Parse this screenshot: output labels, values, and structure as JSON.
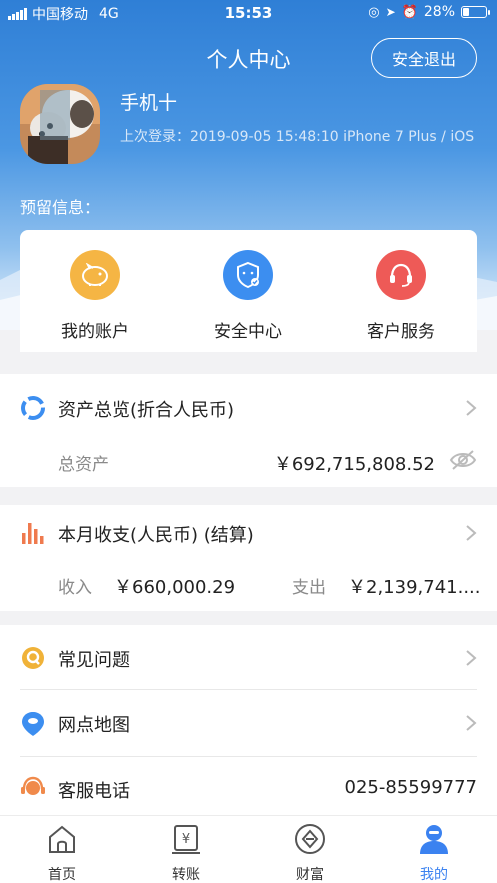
{
  "status_bar": {
    "carrier": "中国移动",
    "network": "4G",
    "time": "15:53",
    "battery": "28%",
    "battery_level": 0.28
  },
  "header": {
    "title": "个人中心",
    "logout_label": "安全退出"
  },
  "profile": {
    "name": "手机十",
    "last_login": "上次登录：2019-09-05 15:48:10  iPhone 7 Plus / iOS",
    "reserved_info_label": "预留信息："
  },
  "quick_actions": [
    {
      "label": "我的账户",
      "icon": "piggy-bank-icon",
      "color": "#f5b544"
    },
    {
      "label": "安全中心",
      "icon": "shield-icon",
      "color": "#3c8ef0"
    },
    {
      "label": "客户服务",
      "icon": "headset-icon",
      "color": "#ee5a57"
    }
  ],
  "assets": {
    "title": "资产总览(折合人民币)",
    "total_label": "总资产",
    "total_value": "￥692,715,808.52"
  },
  "monthly": {
    "title": "本月收支(人民币) (结算)",
    "income_label": "收入",
    "income_value": "￥660,000.29",
    "expense_label": "支出",
    "expense_value": "￥2,139,741...."
  },
  "list": [
    {
      "label": "常见问题",
      "icon": "faq-icon"
    },
    {
      "label": "网点地图",
      "icon": "map-pin-icon"
    },
    {
      "label": "客服电话",
      "icon": "headset-icon",
      "value": "025-85599777"
    }
  ],
  "tabs": [
    {
      "label": "首页",
      "icon": "home-icon"
    },
    {
      "label": "转账",
      "icon": "transfer-icon"
    },
    {
      "label": "财富",
      "icon": "wealth-icon"
    },
    {
      "label": "我的",
      "icon": "user-icon",
      "active": true
    }
  ],
  "colors": {
    "accent": "#3b82f0",
    "header_blue": "#3a88dc"
  }
}
